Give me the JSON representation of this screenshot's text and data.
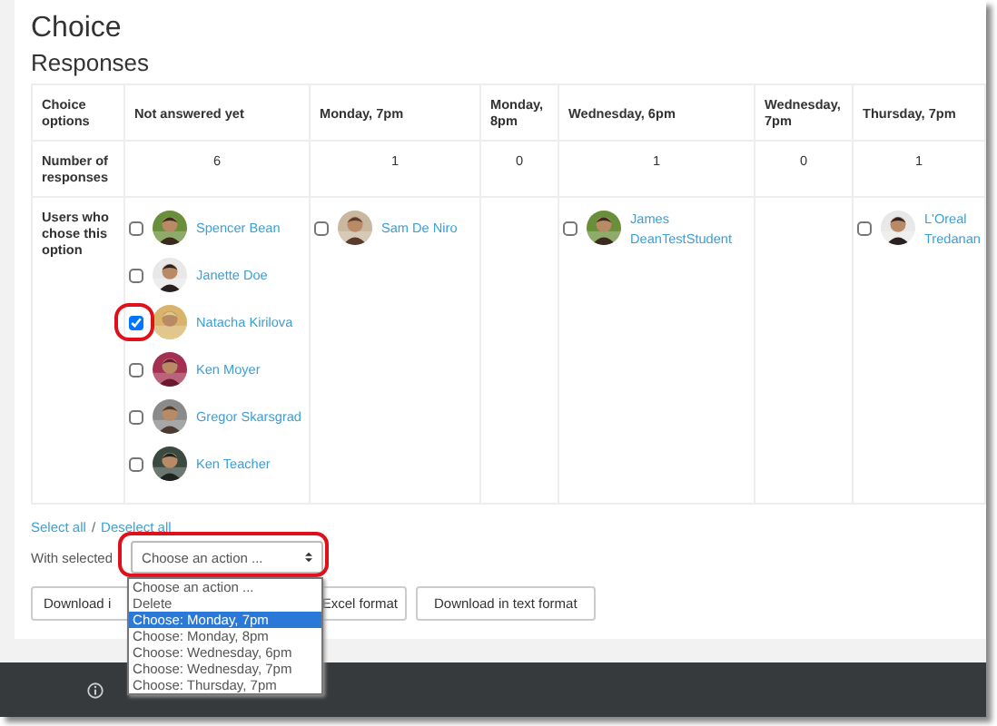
{
  "page": {
    "title": "Choice",
    "subtitle": "Responses"
  },
  "table": {
    "corner": "Choice options",
    "count_label": "Number of responses",
    "users_label": "Users who chose this option",
    "columns": [
      {
        "heading": "Not answered yet",
        "count": "6",
        "users": [
          {
            "name": "Spencer Bean",
            "checked": false,
            "highlighted": false
          },
          {
            "name": "Janette Doe",
            "checked": false,
            "highlighted": false
          },
          {
            "name": "Natacha Kirilova",
            "checked": true,
            "highlighted": true
          },
          {
            "name": "Ken Moyer",
            "checked": false,
            "highlighted": false
          },
          {
            "name": "Gregor Skarsgrad",
            "checked": false,
            "highlighted": false
          },
          {
            "name": "Ken Teacher",
            "checked": false,
            "highlighted": false
          }
        ]
      },
      {
        "heading": "Monday, 7pm",
        "count": "1",
        "users": [
          {
            "name": "Sam De Niro",
            "checked": false,
            "highlighted": false
          }
        ]
      },
      {
        "heading": "Monday, 8pm",
        "count": "0"
      },
      {
        "heading": "Wednesday, 6pm",
        "count": "1",
        "users": [
          {
            "name": "James DeanTestStudent",
            "checked": false,
            "highlighted": false
          }
        ]
      },
      {
        "heading": "Wednesday, 7pm",
        "count": "0"
      },
      {
        "heading": "Thursday, 7pm",
        "count": "1",
        "users": [
          {
            "name": "L'Oreal Tredanan",
            "checked": false,
            "highlighted": false
          }
        ]
      }
    ]
  },
  "links": [
    "Select all",
    "/",
    "Deselect all"
  ],
  "bulk": {
    "label": "With selected",
    "value": "Choose an action ...",
    "highlighted": true,
    "expanded": true,
    "options": [
      {
        "label": "Choose an action ...",
        "highlighted": false
      },
      {
        "label": "Delete",
        "highlighted": false
      },
      {
        "label": "Choose: Monday, 7pm",
        "highlighted": true
      },
      {
        "label": "Choose: Monday, 8pm",
        "highlighted": false
      },
      {
        "label": "Choose: Wednesday, 6pm",
        "highlighted": false
      },
      {
        "label": "Choose: Wednesday, 7pm",
        "highlighted": false
      },
      {
        "label": "Choose: Thursday, 7pm",
        "highlighted": false
      }
    ]
  },
  "buttons": [
    "Download i",
    "Excel format",
    "Download in text format"
  ]
}
